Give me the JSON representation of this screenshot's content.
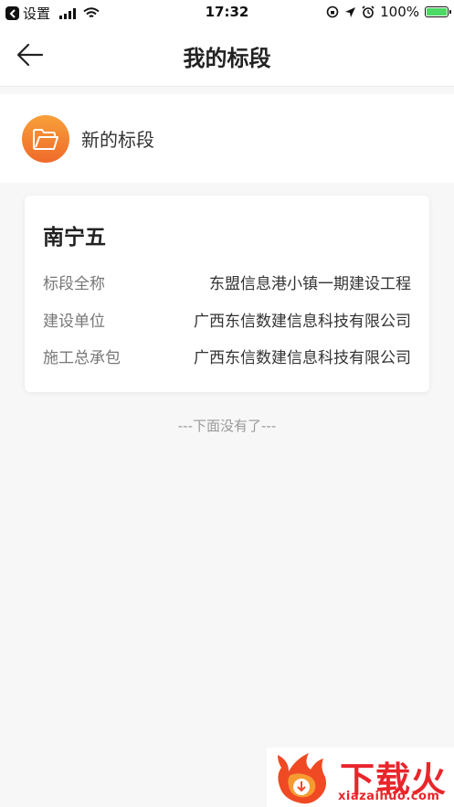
{
  "status_bar": {
    "back_app": "设置",
    "time": "17:32",
    "battery": "100%"
  },
  "nav": {
    "title": "我的标段"
  },
  "new_section": {
    "label": "新的标段",
    "icon": "folder-icon"
  },
  "card": {
    "title": "南宁五",
    "rows": [
      {
        "label": "标段全称",
        "value": "东盟信息港小镇一期建设工程"
      },
      {
        "label": "建设单位",
        "value": "广西东信数建信息科技有限公司"
      },
      {
        "label": "施工总承包",
        "value": "广西东信数建信息科技有限公司"
      }
    ]
  },
  "list_end": "---下面没有了---",
  "watermark": {
    "name": "下载火",
    "domain": "xiazaihuo.com"
  },
  "colors": {
    "accent_orange": "#f08a33",
    "battery_green": "#4cd964",
    "watermark_red": "#e8262b"
  }
}
